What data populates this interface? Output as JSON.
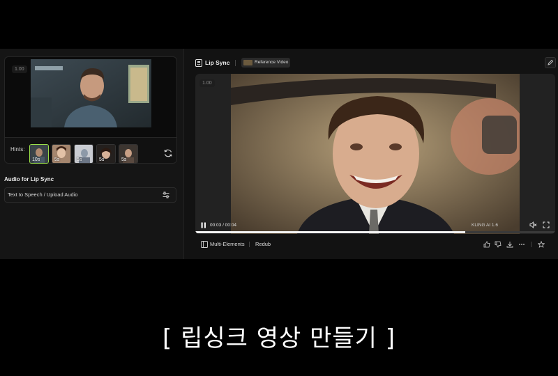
{
  "left_panel": {
    "preview_badge": "1.00",
    "hints_label": "Hints:",
    "hints": [
      {
        "duration": "10s",
        "selected": true
      },
      {
        "duration": "5s",
        "selected": false
      },
      {
        "duration": "5s",
        "selected": false
      },
      {
        "duration": "5s",
        "selected": false
      },
      {
        "duration": "5s",
        "selected": false
      }
    ],
    "audio_section_title": "Audio for Lip Sync",
    "audio_source": "Text to Speech / Upload Audio"
  },
  "right_panel": {
    "title": "Lip Sync",
    "reference_button": "Reference Video",
    "video_badge": "1.00",
    "time": "00:03 / 00:04",
    "progress": 0.75,
    "watermark": "KLING AI 1.6",
    "bottom": {
      "multi_elements": "Multi-Elements",
      "redub": "Redub"
    }
  },
  "caption": "[ 립싱크 영상 만들기 ]",
  "colors": {
    "accent_selected": "#9be04a",
    "background": "#121212"
  },
  "icons": [
    "refresh-icon",
    "settings-sliders-icon",
    "lip-sync-icon",
    "edit-icon",
    "pause-icon",
    "mute-icon",
    "fullscreen-icon",
    "layers-icon",
    "thumbs-up-icon",
    "thumbs-down-icon",
    "download-icon",
    "more-icon",
    "star-icon"
  ]
}
